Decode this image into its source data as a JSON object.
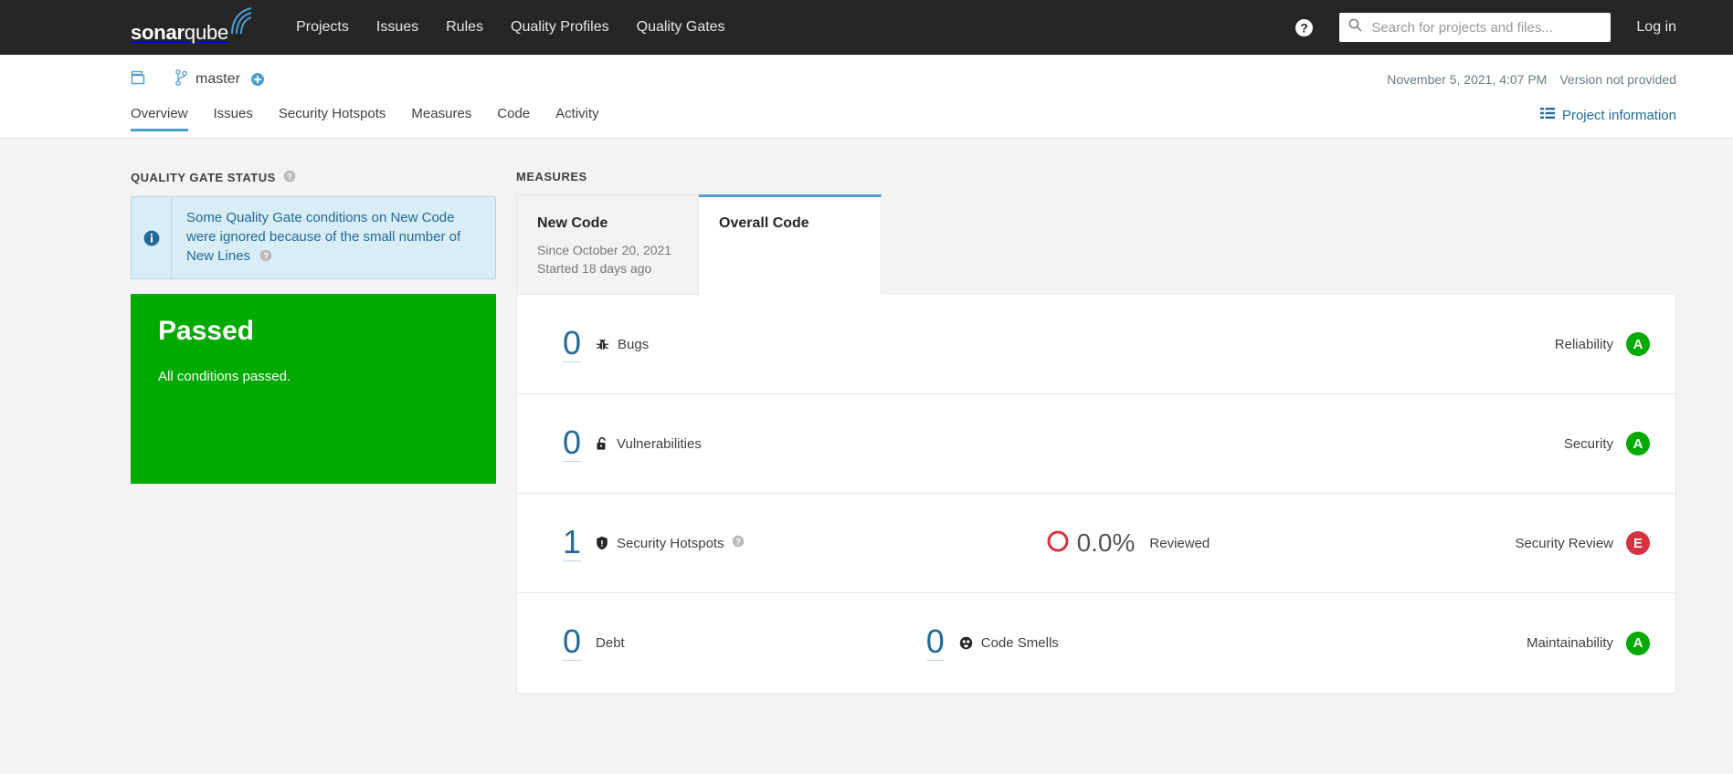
{
  "topnav": {
    "brand_bold": "sonar",
    "brand_light": "qube",
    "links": [
      {
        "label": "Projects",
        "name": "projects"
      },
      {
        "label": "Issues",
        "name": "issues"
      },
      {
        "label": "Rules",
        "name": "rules"
      },
      {
        "label": "Quality Profiles",
        "name": "quality-profiles"
      },
      {
        "label": "Quality Gates",
        "name": "quality-gates"
      }
    ],
    "help_icon": "help-circle-icon",
    "search": {
      "icon": "search-icon",
      "placeholder": "Search for projects and files...",
      "value": ""
    },
    "login_label": "Log in"
  },
  "context": {
    "project_icon": "project-icon",
    "project_name": "",
    "branch_icon": "branch-icon",
    "branch_name": "master",
    "favorite_icon": "star-add-icon",
    "analysis_date": "November 5, 2021, 4:07 PM",
    "version": "Version not provided",
    "tabs": [
      {
        "label": "Overview",
        "name": "overview",
        "active": true
      },
      {
        "label": "Issues",
        "name": "issues",
        "active": false
      },
      {
        "label": "Security Hotspots",
        "name": "security-hotspots",
        "active": false
      },
      {
        "label": "Measures",
        "name": "measures",
        "active": false
      },
      {
        "label": "Code",
        "name": "code",
        "active": false
      },
      {
        "label": "Activity",
        "name": "activity",
        "active": false
      }
    ],
    "project_information": {
      "icon": "list-icon",
      "label": "Project information"
    }
  },
  "quality_gate": {
    "section_title": "QUALITY GATE STATUS",
    "section_help_icon": "help-icon",
    "notice": {
      "icon": "info-icon",
      "text": "Some Quality Gate conditions on New Code were ignored because of the small number of New Lines",
      "help_icon": "help-icon"
    },
    "status": "Passed",
    "status_detail": "All conditions passed.",
    "status_color": "#00aa00"
  },
  "measures": {
    "section_title": "MEASURES",
    "tabs": [
      {
        "name": "new-code",
        "title": "New Code",
        "sub_line_1": "Since October 20, 2021",
        "sub_line_2": "Started 18 days ago",
        "active": false
      },
      {
        "name": "overall-code",
        "title": "Overall Code",
        "sub_line_1": "",
        "sub_line_2": "",
        "active": true
      }
    ],
    "rows": [
      {
        "name": "bugs",
        "value": "0",
        "icon": "bug-icon",
        "label": "Bugs",
        "has_help": false,
        "secondary": null,
        "rating_label": "Reliability",
        "rating_letter": "A",
        "rating_color": "#00aa00"
      },
      {
        "name": "vulnerabilities",
        "value": "0",
        "icon": "vulnerability-lock-icon",
        "label": "Vulnerabilities",
        "has_help": false,
        "secondary": null,
        "rating_label": "Security",
        "rating_letter": "A",
        "rating_color": "#00aa00"
      },
      {
        "name": "security-hotspots",
        "value": "1",
        "icon": "shield-icon",
        "label": "Security Hotspots",
        "has_help": true,
        "secondary": {
          "donut_icon": "donut-chart-icon",
          "donut_percent": 0,
          "donut_color": "#d4333f",
          "value": "0.0%",
          "label": "Reviewed"
        },
        "rating_label": "Security Review",
        "rating_letter": "E",
        "rating_color": "#d4333f"
      },
      {
        "name": "maintainability",
        "value": "0",
        "icon": null,
        "label": "Debt",
        "has_help": false,
        "secondary": {
          "value": "0",
          "icon": "code-smell-icon",
          "label": "Code Smells"
        },
        "rating_label": "Maintainability",
        "rating_letter": "A",
        "rating_color": "#00aa00"
      }
    ]
  }
}
